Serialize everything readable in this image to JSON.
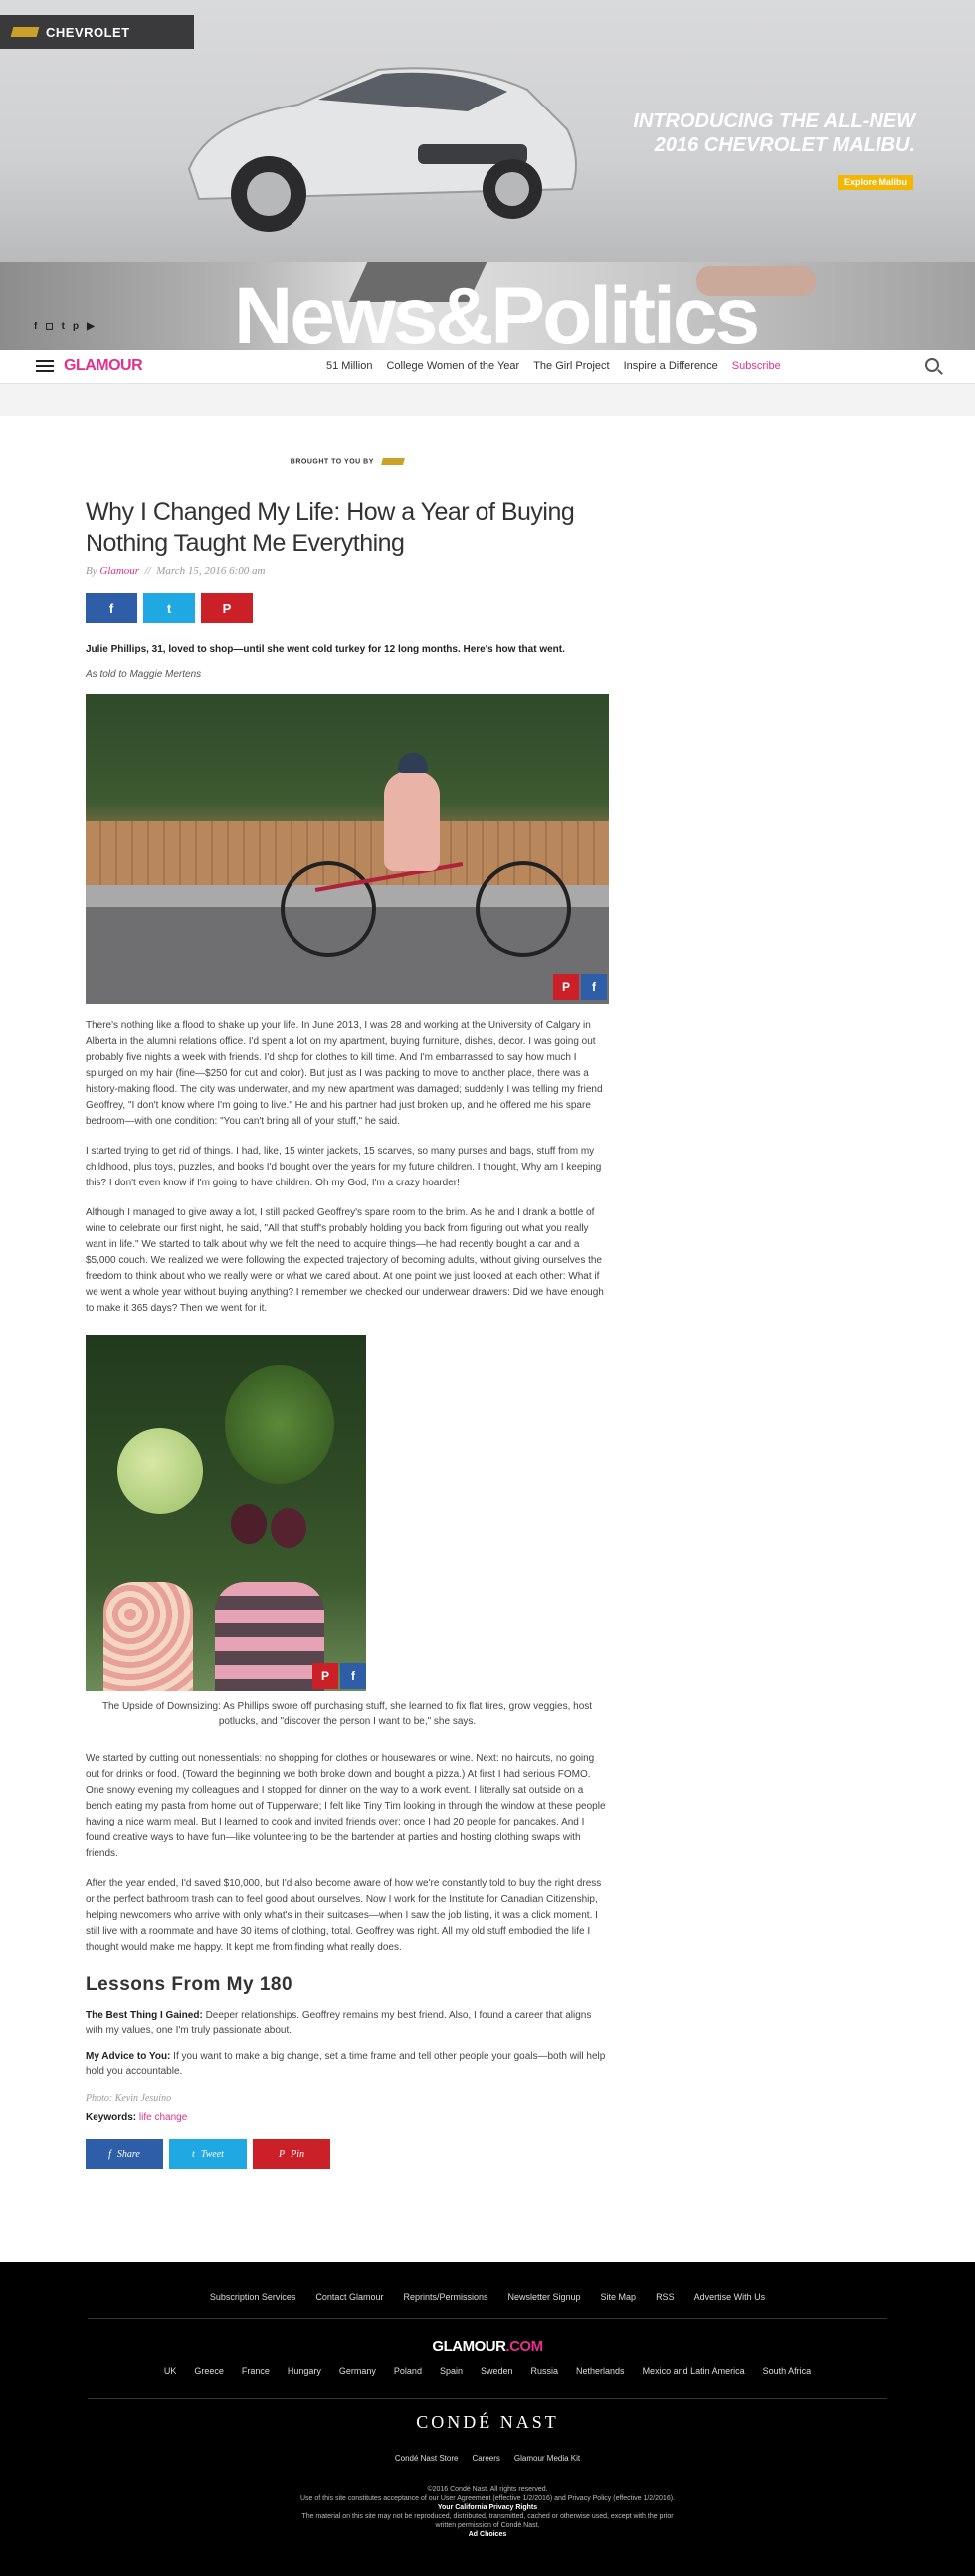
{
  "ad": {
    "brand": "CHEVROLET",
    "headline_1": "INTRODUCING THE ALL-NEW",
    "headline_2": "2016 CHEVROLET MALIBU.",
    "cta": "Explore Malibu"
  },
  "hero": {
    "title": "News&Politics",
    "social_icons": [
      "facebook-icon",
      "instagram-icon",
      "twitter-icon",
      "pinterest-icon",
      "youtube-icon"
    ]
  },
  "nav": {
    "logo": "GLAMOUR",
    "links": [
      "51 Million",
      "College Women of the Year",
      "The Girl Project",
      "Inspire a Difference"
    ],
    "subscribe": "Subscribe"
  },
  "article": {
    "sponsor": "BROUGHT TO YOU BY",
    "title": "Why I Changed My Life: How a Year of Buying Nothing Taught Me Everything",
    "by": "By",
    "author": "Glamour",
    "date": "March 15, 2016 6:00 am",
    "dek": "Julie Phillips, 31, loved to shop—until she went cold turkey for 12 long months. Here's how that went.",
    "as_told": "As told to Maggie Mertens",
    "paragraphs": [
      "There's nothing like a flood to shake up your life. In June 2013, I was 28 and working at the University of Calgary in Alberta in the alumni relations office. I'd spent a lot on my apartment, buying furniture, dishes, decor. I was going out probably five nights a week with friends. I'd shop for clothes to kill time. And I'm embarrassed to say how much I splurged on my hair (fine—$250 for cut and color). But just as I was packing to move to another place, there was a history-making flood. The city was underwater, and my new apartment was damaged; suddenly I was telling my friend Geoffrey, \"I don't know where I'm going to live.\" He and his partner had just broken up, and he offered me his spare bedroom—with one condition: \"You can't bring all of your stuff,\" he said.",
      "I started trying to get rid of things. I had, like, 15 winter jackets, 15 scarves, so many purses and bags, stuff from my childhood, plus toys, puzzles, and books I'd bought over the years for my future children. I thought, Why am I keeping this? I don't even know if I'm going to have children. Oh my God, I'm a crazy hoarder!",
      "Although I managed to give away a lot, I still packed Geoffrey's spare room to the brim. As he and I drank a bottle of wine to celebrate our first night, he said, \"All that stuff's probably holding you back from figuring out what you really want in life.\" We started to talk about why we felt the need to acquire things—he had recently bought a car and a $5,000 couch. We realized we were following the expected trajectory of becoming adults, without giving ourselves the freedom to think about who we really were or what we cared about. At one point we just looked at each other: What if we went a whole year without buying anything? I remember we checked our underwear drawers: Did we have enough to make it 365 days? Then we went for it."
    ],
    "caption": "The Upside of Downsizing: As Phillips swore off purchasing stuff, she learned to fix flat tires, grow veggies, host potlucks, and \"discover the person I want to be,\" she says.",
    "paragraphs_2": [
      "We started by cutting out nonessentials: no shopping for clothes or housewares or wine. Next: no haircuts, no going out for drinks or food. (Toward the beginning we both broke down and bought a pizza.) At first I had serious FOMO. One snowy evening my colleagues and I stopped for dinner on the way to a work event. I literally sat outside on a bench eating my pasta from home out of Tupperware; I felt like Tiny Tim looking in through the window at these people having a nice warm meal. But I learned to cook and invited friends over; once I had 20 people for pancakes. And I found creative ways to have fun—like volunteering to be the bartender at parties and hosting clothing swaps with friends.",
      "After the year ended, I'd saved $10,000, but I'd also become aware of how we're constantly told to buy the right dress or the perfect bathroom trash can to feel good about ourselves. Now I work for the Institute for Canadian Citizenship, helping newcomers who arrive with only what's in their suitcases—when I saw the job listing, it was a click moment. I still live with a roommate and have 30 items of clothing, total. Geoffrey was right. All my old stuff embodied the life I thought would make me happy. It kept me from finding what really does."
    ],
    "lessons_heading": "Lessons From My 180",
    "lesson_1_label": "The Best Thing I Gained:",
    "lesson_1_text": " Deeper relationships. Geoffrey remains my best friend. Also, I found a career that aligns with my values, one I'm truly passionate about.",
    "lesson_2_label": "My Advice to You:",
    "lesson_2_text": " If you want to make a big change, set a time frame and tell other people your goals—both will help hold you accountable.",
    "photo_credit": "Photo: Kevin Jesuino",
    "keywords_label": "Keywords:",
    "keywords_value": "life change",
    "share_labels": {
      "facebook": "Share",
      "twitter": "Tweet",
      "pinterest": "Pin"
    }
  },
  "footer": {
    "links": [
      "Subscription Services",
      "Contact Glamour",
      "Reprints/Permissions",
      "Newsletter Signup",
      "Site Map",
      "RSS",
      "Advertise With Us"
    ],
    "logo_main": "GLAMOUR",
    "logo_suffix": ".COM",
    "countries": [
      "UK",
      "Greece",
      "France",
      "Hungary",
      "Germany",
      "Poland",
      "Spain",
      "Sweden",
      "Russia",
      "Netherlands",
      "Mexico and Latin America",
      "South Africa"
    ],
    "conde": "CONDÉ NAST",
    "conde_links": [
      "Condé Nast Store",
      "Careers",
      "Glamour Media Kit"
    ],
    "legal_1": "©2016 Condé Nast. All rights reserved.",
    "legal_2": "Use of this site constitutes acceptance of our User Agreement (effective 1/2/2016) and Privacy Policy (effective 1/2/2016).",
    "legal_3": "Your California Privacy Rights",
    "legal_4": "The material on this site may not be reproduced, distributed, transmitted, cached or otherwise used, except with the prior written permission of Condé Nast.",
    "legal_5": "Ad Choices"
  },
  "colors": {
    "brand_pink": "#e2308b",
    "facebook": "#2f5ea8",
    "twitter": "#20a8e3",
    "pinterest": "#cb2027"
  }
}
